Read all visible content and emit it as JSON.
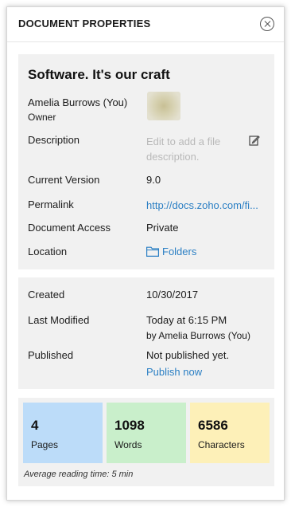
{
  "header": {
    "title": "DOCUMENT PROPERTIES",
    "close_icon": "close-circle-icon"
  },
  "document": {
    "title": "Software. It's our craft",
    "owner_name": "Amelia Burrows (You)",
    "owner_role": "Owner",
    "description_label": "Description",
    "description_placeholder": "Edit to add a file description.",
    "current_version_label": "Current Version",
    "current_version": "9.0",
    "permalink_label": "Permalink",
    "permalink": "http://docs.zoho.com/fi...",
    "access_label": "Document Access",
    "access": "Private",
    "location_label": "Location",
    "location": "Folders"
  },
  "dates": {
    "created_label": "Created",
    "created": "10/30/2017",
    "modified_label": "Last Modified",
    "modified_time": "Today at 6:15 PM",
    "modified_by": "by Amelia Burrows (You)",
    "published_label": "Published",
    "published_status": "Not published yet.",
    "publish_link": "Publish now"
  },
  "stats": [
    {
      "value": "4",
      "label": "Pages",
      "color": "#bcdcf9"
    },
    {
      "value": "1098",
      "label": "Words",
      "color": "#c9efcb"
    },
    {
      "value": "6586",
      "label": "Characters",
      "color": "#fdf0b8"
    }
  ],
  "reading_time": "Average reading time: 5 min",
  "colors": {
    "link": "#2b7fc4",
    "card_bg": "#f1f1f1"
  }
}
